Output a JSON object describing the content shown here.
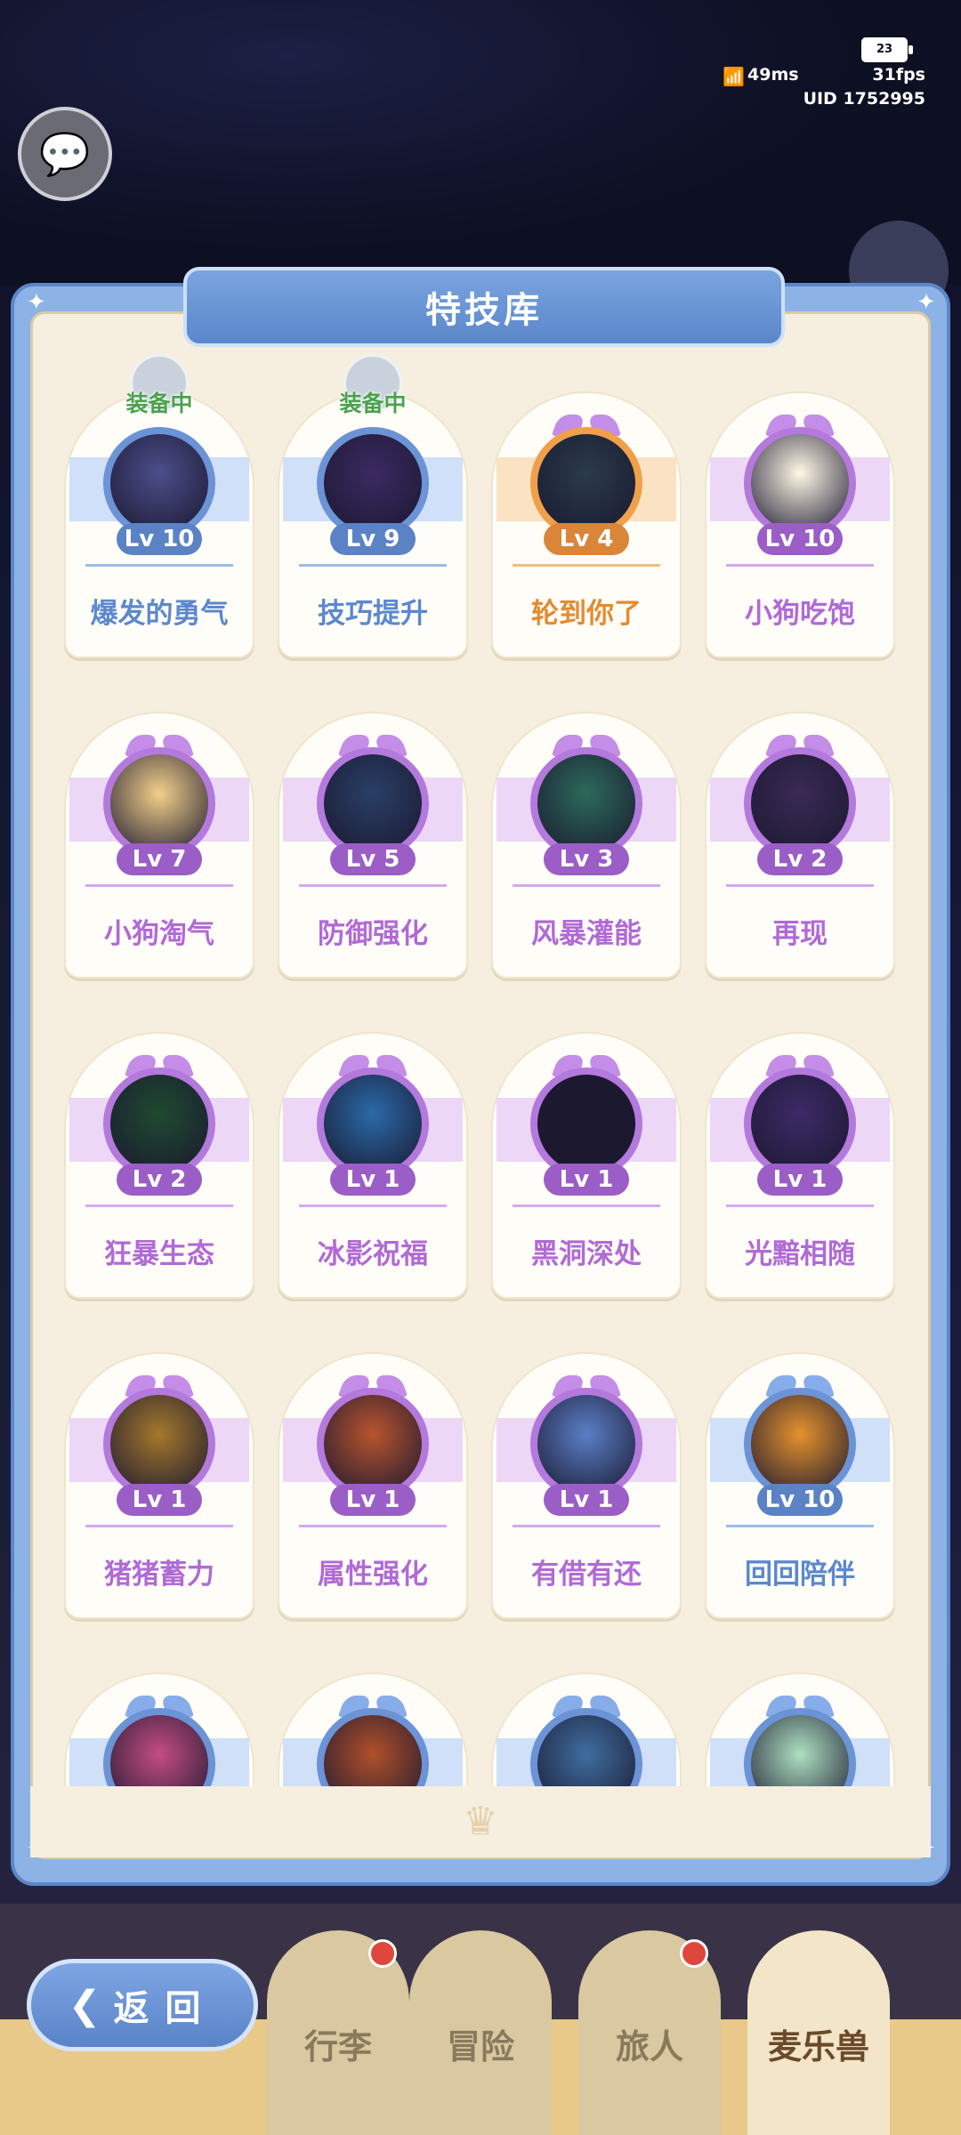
{
  "status": {
    "battery": "23",
    "ping": "49ms",
    "fps": "31fps",
    "uid": "UID 1752995"
  },
  "panel": {
    "title": "特技库"
  },
  "equipped_label": "装备中",
  "skills": [
    {
      "level": "Lv 10",
      "name": "爆发的勇气",
      "theme": "blue",
      "equipped": true
    },
    {
      "level": "Lv 9",
      "name": "技巧提升",
      "theme": "blue",
      "equipped": true
    },
    {
      "level": "Lv 4",
      "name": "轮到你了",
      "theme": "orange",
      "equipped": false
    },
    {
      "level": "Lv 10",
      "name": "小狗吃饱",
      "theme": "purple",
      "equipped": false
    },
    {
      "level": "Lv 7",
      "name": "小狗淘气",
      "theme": "purple",
      "equipped": false
    },
    {
      "level": "Lv 5",
      "name": "防御强化",
      "theme": "purple",
      "equipped": false
    },
    {
      "level": "Lv 3",
      "name": "风暴灌能",
      "theme": "purple",
      "equipped": false
    },
    {
      "level": "Lv 2",
      "name": "再现",
      "theme": "purple",
      "equipped": false
    },
    {
      "level": "Lv 2",
      "name": "狂暴生态",
      "theme": "purple",
      "equipped": false
    },
    {
      "level": "Lv 1",
      "name": "冰影祝福",
      "theme": "purple",
      "equipped": false
    },
    {
      "level": "Lv 1",
      "name": "黑洞深处",
      "theme": "purple",
      "equipped": false
    },
    {
      "level": "Lv 1",
      "name": "光黯相随",
      "theme": "purple",
      "equipped": false
    },
    {
      "level": "Lv 1",
      "name": "猪猪蓄力",
      "theme": "purple",
      "equipped": false
    },
    {
      "level": "Lv 1",
      "name": "属性强化",
      "theme": "purple",
      "equipped": false
    },
    {
      "level": "Lv 1",
      "name": "有借有还",
      "theme": "purple",
      "equipped": false
    },
    {
      "level": "Lv 10",
      "name": "回回陪伴",
      "theme": "blue",
      "equipped": false
    }
  ],
  "portrait_colors": [
    "#4b4e8a",
    "#3b2a63",
    "#2a3b4a",
    "#fff8e6",
    "#f3d08a",
    "#2a3f66",
    "#2c6a5a",
    "#3a2a55",
    "#1f4a30",
    "#2a6aa8",
    "#1c1830",
    "#3d2a66",
    "#a5782c",
    "#b8542e",
    "#5a7fc6",
    "#e5922c"
  ],
  "partial_row_colors": [
    "#c44d82",
    "#b0502a",
    "#3f6ea0",
    "#aee0c0"
  ],
  "back_button": {
    "label": "返回"
  },
  "bottom_tabs": [
    {
      "label": "行李",
      "badge": true
    },
    {
      "label": "冒险",
      "badge": false
    },
    {
      "label": "旅人",
      "badge": true
    },
    {
      "label": "麦乐兽",
      "badge": false
    }
  ]
}
